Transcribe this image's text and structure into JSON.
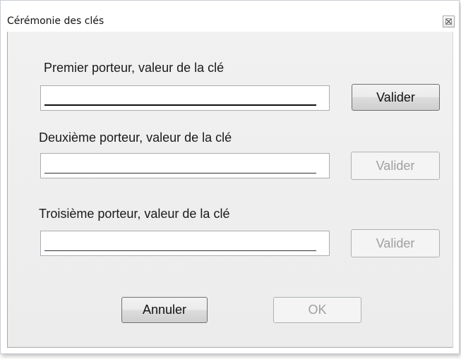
{
  "window": {
    "title": "Cérémonie des clés"
  },
  "icons": {
    "close": "close-icon"
  },
  "carriers": [
    {
      "label": "Premier porteur, valeur de la clé",
      "value": "",
      "button_label": "Valider",
      "button_enabled": true
    },
    {
      "label": "Deuxième porteur, valeur de la clé",
      "value": "",
      "button_label": "Valider",
      "button_enabled": false
    },
    {
      "label": "Troisième porteur, valeur de la clé",
      "value": "",
      "button_label": "Valider",
      "button_enabled": false
    }
  ],
  "footer": {
    "cancel_label": "Annuler",
    "ok_label": "OK",
    "ok_enabled": false
  }
}
